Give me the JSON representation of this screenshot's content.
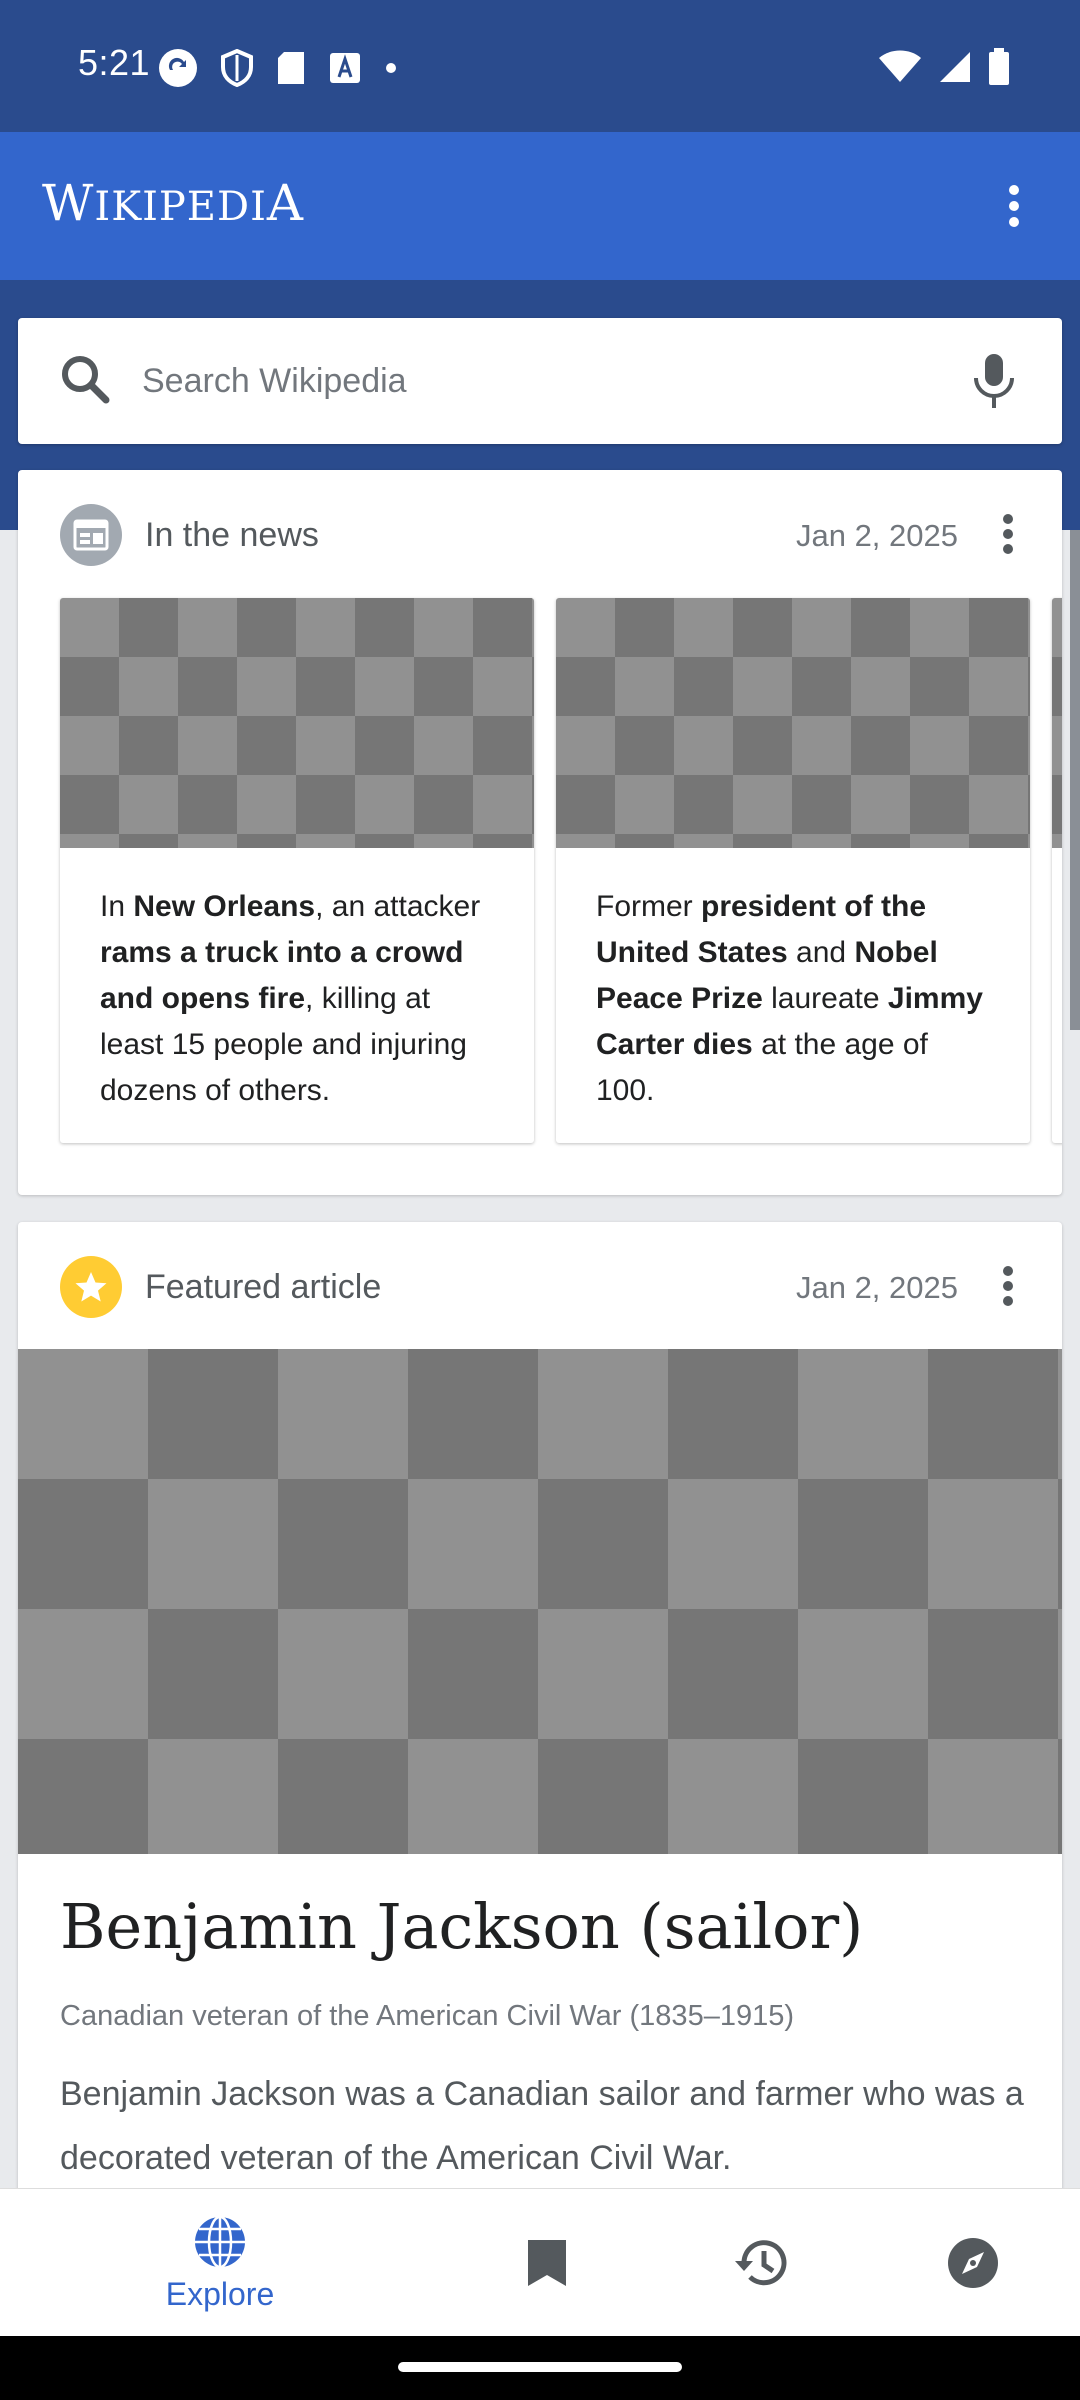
{
  "status_bar": {
    "time": "5:21"
  },
  "app_bar": {
    "logo_first": "W",
    "logo_rest": "IKIPEDI",
    "logo_last": "A"
  },
  "search": {
    "placeholder": "Search Wikipedia"
  },
  "news_card": {
    "title": "In the news",
    "date": "Jan 2, 2025",
    "items": [
      {
        "parts": [
          "In ",
          "New Orleans",
          ", an attacker ",
          "rams a truck into a crowd and opens fire",
          ", killing at least 15 people and injuring dozens of others."
        ]
      },
      {
        "parts": [
          "Former ",
          "president of the United States",
          " and ",
          "Nobel Peace Prize",
          " laureate ",
          "Jimmy Carter dies",
          " at the age of 100."
        ]
      }
    ]
  },
  "featured_card": {
    "title": "Featured article",
    "date": "Jan 2, 2025",
    "article_title": "Benjamin Jackson (sailor)",
    "article_subtitle": "Canadian veteran of the American Civil War (1835–1915)",
    "article_extract": "Benjamin Jackson was a Canadian sailor and farmer who was a decorated veteran of the American Civil War."
  },
  "bottom_nav": {
    "explore_label": "Explore",
    "active": "explore"
  },
  "colors": {
    "brand_blue": "#3366cc",
    "dark_blue": "#2a4b8d",
    "featured_yellow": "#fc3",
    "header_gray": "#a2a9b1"
  }
}
